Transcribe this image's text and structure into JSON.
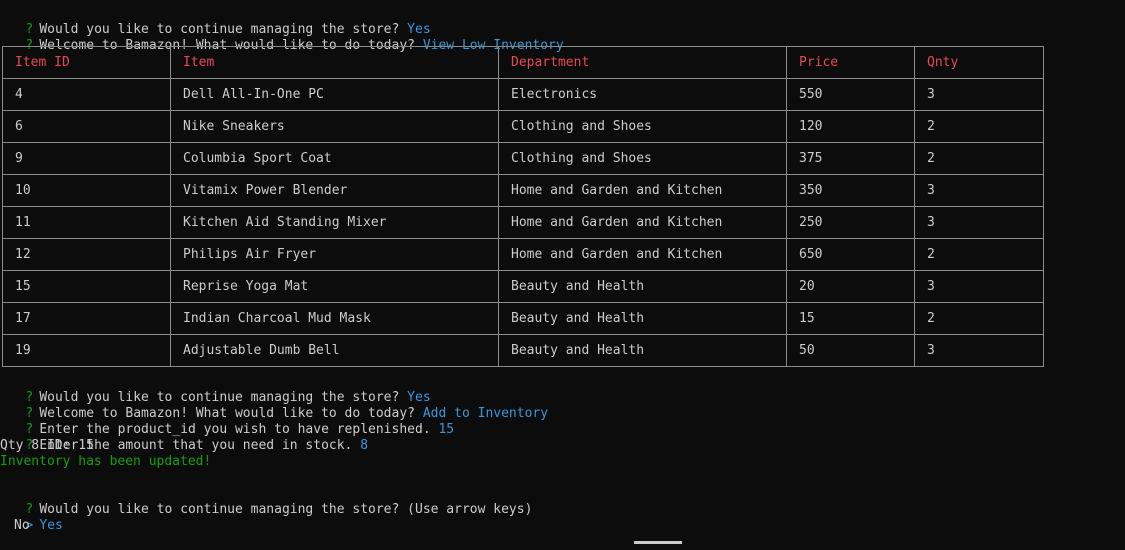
{
  "lines": {
    "l1_q": "Would you like to continue managing the store?",
    "l1_a": "Yes",
    "l2_q": "Welcome to Bamazon! What would like to do today?",
    "l2_a": "View Low Inventory",
    "l3_q": "Would you like to continue managing the store?",
    "l3_a": "Yes",
    "l4_q": "Welcome to Bamazon! What would like to do today?",
    "l4_a": "Add to Inventory",
    "l5_q": "Enter the product_id you wish to have replenished.",
    "l5_a": "15",
    "l6_q": "Enter the amount that you need in stock.",
    "l6_a": "8",
    "l7": "Qty 8 ID: 15",
    "l8": "Inventory has been updated!",
    "l9_q": "Would you like to continue managing the store? (Use arrow keys)",
    "opt_selected": "Yes",
    "opt_other": "No",
    "prompt_mark": "?",
    "pointer_mark": ">"
  },
  "table": {
    "headers": [
      "Item ID",
      "Item",
      "Department",
      "Price",
      "Qnty"
    ],
    "rows": [
      [
        "4",
        "Dell All-In-One PC",
        "Electronics",
        "550",
        "3"
      ],
      [
        "6",
        "Nike Sneakers",
        "Clothing and Shoes",
        "120",
        "2"
      ],
      [
        "9",
        "Columbia Sport Coat",
        "Clothing and Shoes",
        "375",
        "2"
      ],
      [
        "10",
        "Vitamix Power Blender",
        "Home and Garden and Kitchen",
        "350",
        "3"
      ],
      [
        "11",
        "Kitchen Aid Standing Mixer",
        "Home and Garden and Kitchen",
        "250",
        "3"
      ],
      [
        "12",
        "Philips Air Fryer",
        "Home and Garden and Kitchen",
        "650",
        "2"
      ],
      [
        "15",
        "Reprise Yoga Mat",
        "Beauty and Health",
        "20",
        "3"
      ],
      [
        "17",
        "Indian Charcoal Mud Mask",
        "Beauty and Health",
        "15",
        "2"
      ],
      [
        "19",
        "Adjustable Dumb Bell",
        "Beauty and Health",
        "50",
        "3"
      ]
    ]
  },
  "colors": {
    "background": "#0c0c0c",
    "text": "#cccccc",
    "prompt_green": "#13a10e",
    "answer_blue": "#3a96dd",
    "header_red": "#e74856",
    "border": "#8a8a8a"
  }
}
